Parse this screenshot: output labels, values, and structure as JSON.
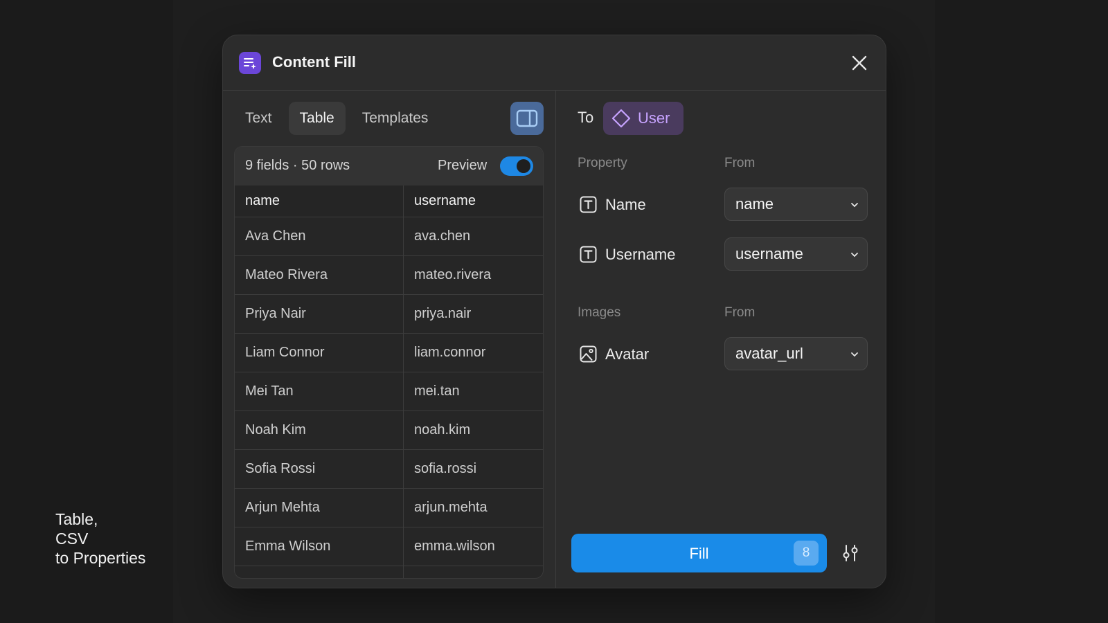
{
  "caption": {
    "line1": "Table,",
    "line2": "CSV",
    "line3": "to Properties"
  },
  "modal": {
    "title": "Content Fill",
    "icon": "list-sparkle-icon",
    "close_icon": "close-icon"
  },
  "tabs": [
    {
      "label": "Text",
      "active": false
    },
    {
      "label": "Table",
      "active": true
    },
    {
      "label": "Templates",
      "active": false
    }
  ],
  "table": {
    "summary": "9 fields · 50 rows",
    "preview_label": "Preview",
    "preview_on": true,
    "columns": [
      "name",
      "username"
    ],
    "rows": [
      [
        "Ava Chen",
        "ava.chen"
      ],
      [
        "Mateo Rivera",
        "mateo.rivera"
      ],
      [
        "Priya Nair",
        "priya.nair"
      ],
      [
        "Liam Connor",
        "liam.connor"
      ],
      [
        "Mei Tan",
        "mei.tan"
      ],
      [
        "Noah Kim",
        "noah.kim"
      ],
      [
        "Sofia Rossi",
        "sofia.rossi"
      ],
      [
        "Arjun Mehta",
        "arjun.mehta"
      ],
      [
        "Emma Wilson",
        "emma.wilson"
      ]
    ]
  },
  "target": {
    "to_label": "To",
    "component": "User"
  },
  "properties": {
    "header_property": "Property",
    "header_from": "From",
    "items": [
      {
        "name": "Name",
        "from": "name"
      },
      {
        "name": "Username",
        "from": "username"
      }
    ]
  },
  "images": {
    "header_images": "Images",
    "header_from": "From",
    "items": [
      {
        "name": "Avatar",
        "from": "avatar_url"
      }
    ]
  },
  "actions": {
    "fill_label": "Fill",
    "fill_count": "8"
  },
  "colors": {
    "accent": "#1a8be8",
    "component_chip": "#4a3b5e",
    "component_text": "#c7a3ff",
    "app_icon": "#6b46d8"
  }
}
